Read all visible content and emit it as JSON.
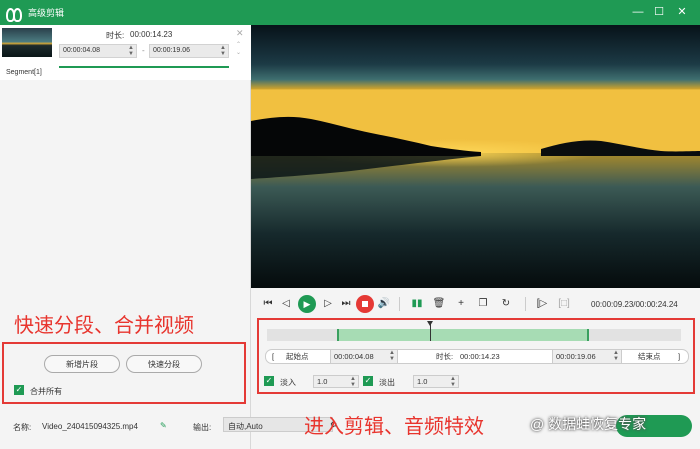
{
  "window": {
    "title": "高级剪辑",
    "minimize": "—",
    "maximize": "☐",
    "close": "✕"
  },
  "segment": {
    "name": "Segment[1]",
    "duration_label": "时长:",
    "duration_value": "00:00:14.23",
    "start": "00:00:04.08",
    "end": "00:00:19.06",
    "dash": "-"
  },
  "left_annotation": "快速分段、合并视频",
  "left_actions": {
    "new_segment": "新增片段",
    "quick_split": "快速分段",
    "merge_all": "合并所有"
  },
  "player": {
    "time_display": "00:00:09.23/00:00:24.24",
    "icons": [
      "skip-start-icon",
      "step-back-icon",
      "play-icon",
      "step-forward-icon",
      "skip-end-icon",
      "stop-icon",
      "volume-icon",
      "split-icon",
      "delete-icon",
      "add-icon",
      "copy-icon",
      "reset-icon",
      "mark-in-icon",
      "mark-out-icon"
    ]
  },
  "trim": {
    "start_button": "起始点",
    "start_value": "00:00:04.08",
    "duration_label": "时长:",
    "duration_value": "00:00:14.23",
    "end_value": "00:00:19.06",
    "end_button": "结束点",
    "fade_in_label": "淡入",
    "fade_in_value": "1.0",
    "fade_out_label": "淡出",
    "fade_out_value": "1.0"
  },
  "right_annotation": "进入剪辑、音频特效",
  "bottom": {
    "name_label": "名称:",
    "name_value": "Video_240415094325.mp4",
    "output_label": "输出:",
    "output_value": "自动,Auto",
    "watermark": "@ 数据蛙恢复专家"
  },
  "colors": {
    "brand_green": "#1f9a54",
    "annotation_red": "#e43a36",
    "selection_green": "#a7dcb4"
  }
}
